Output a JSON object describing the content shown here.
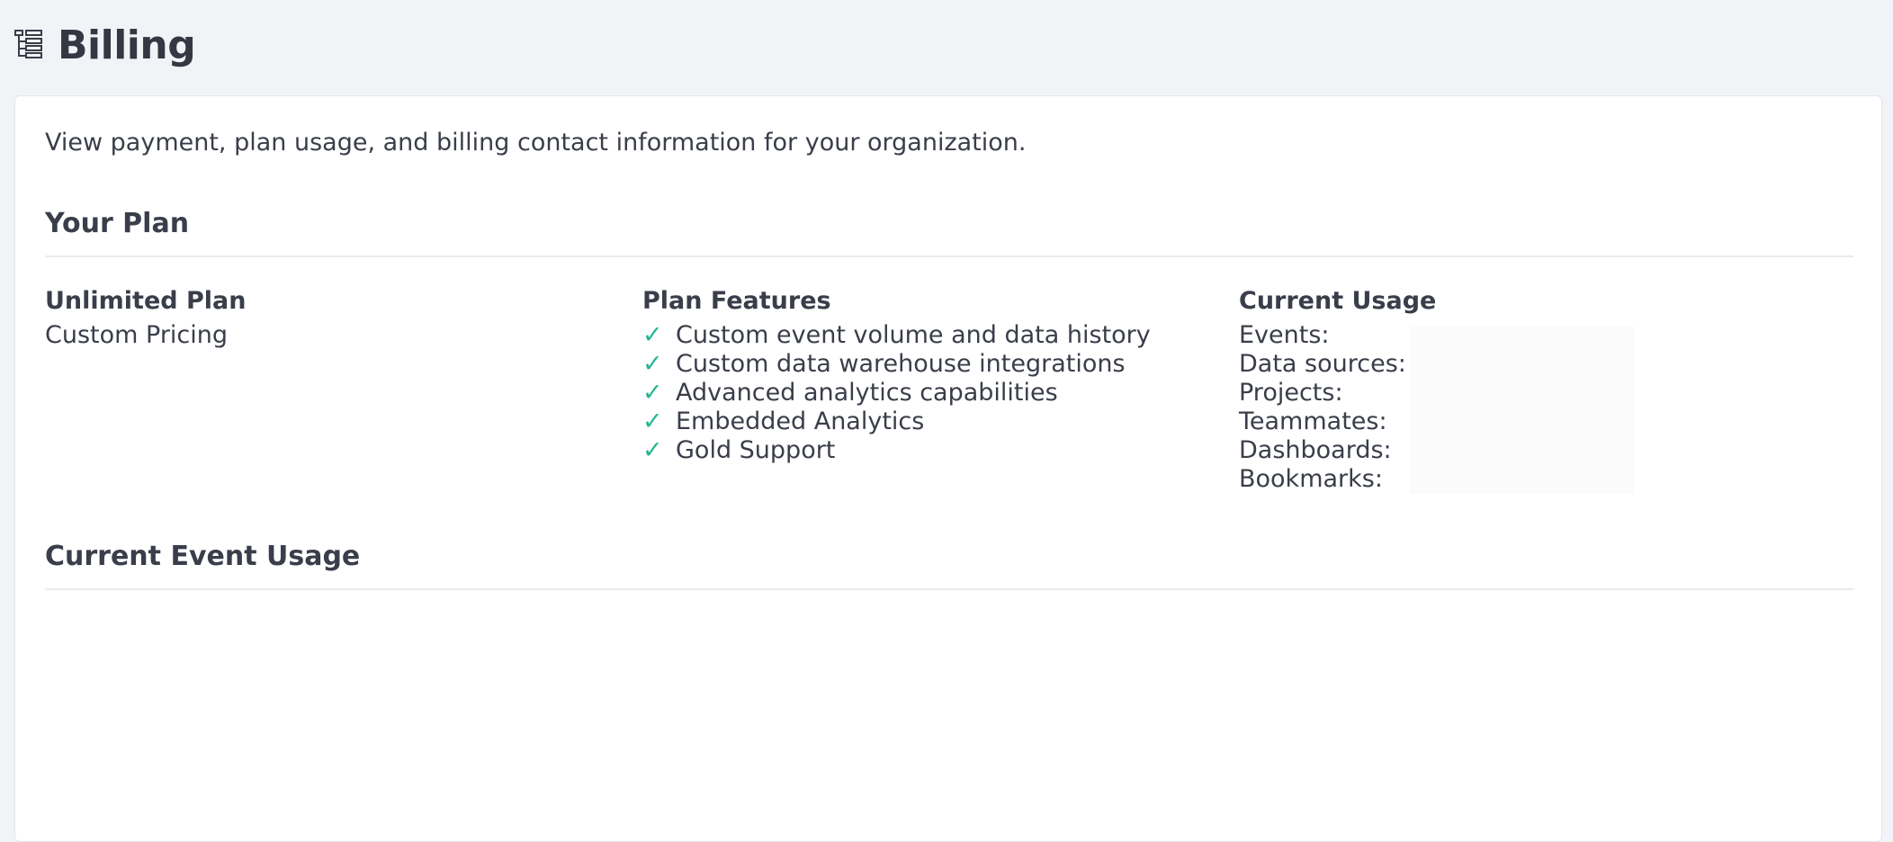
{
  "header": {
    "title": "Billing",
    "icon": "tree-structure-icon"
  },
  "intro": "View payment, plan usage, and billing contact information for your organization.",
  "your_plan": {
    "section_title": "Your Plan",
    "plan": {
      "name": "Unlimited Plan",
      "pricing": "Custom Pricing"
    },
    "features": {
      "heading": "Plan Features",
      "check_glyph": "✓",
      "items": [
        "Custom event volume and data history",
        "Custom data warehouse integrations",
        "Advanced analytics capabilities",
        "Embedded Analytics",
        "Gold Support"
      ]
    },
    "usage": {
      "heading": "Current Usage",
      "labels": [
        "Events:",
        "Data sources:",
        "Projects:",
        "Teammates:",
        "Dashboards:",
        "Bookmarks:"
      ]
    }
  },
  "event_usage": {
    "section_title": "Current Event Usage"
  },
  "colors": {
    "background": "#f1f3f7",
    "panel": "#ffffff",
    "text": "#3a3e4a",
    "check": "#25b592",
    "rule": "#e9ebef"
  }
}
